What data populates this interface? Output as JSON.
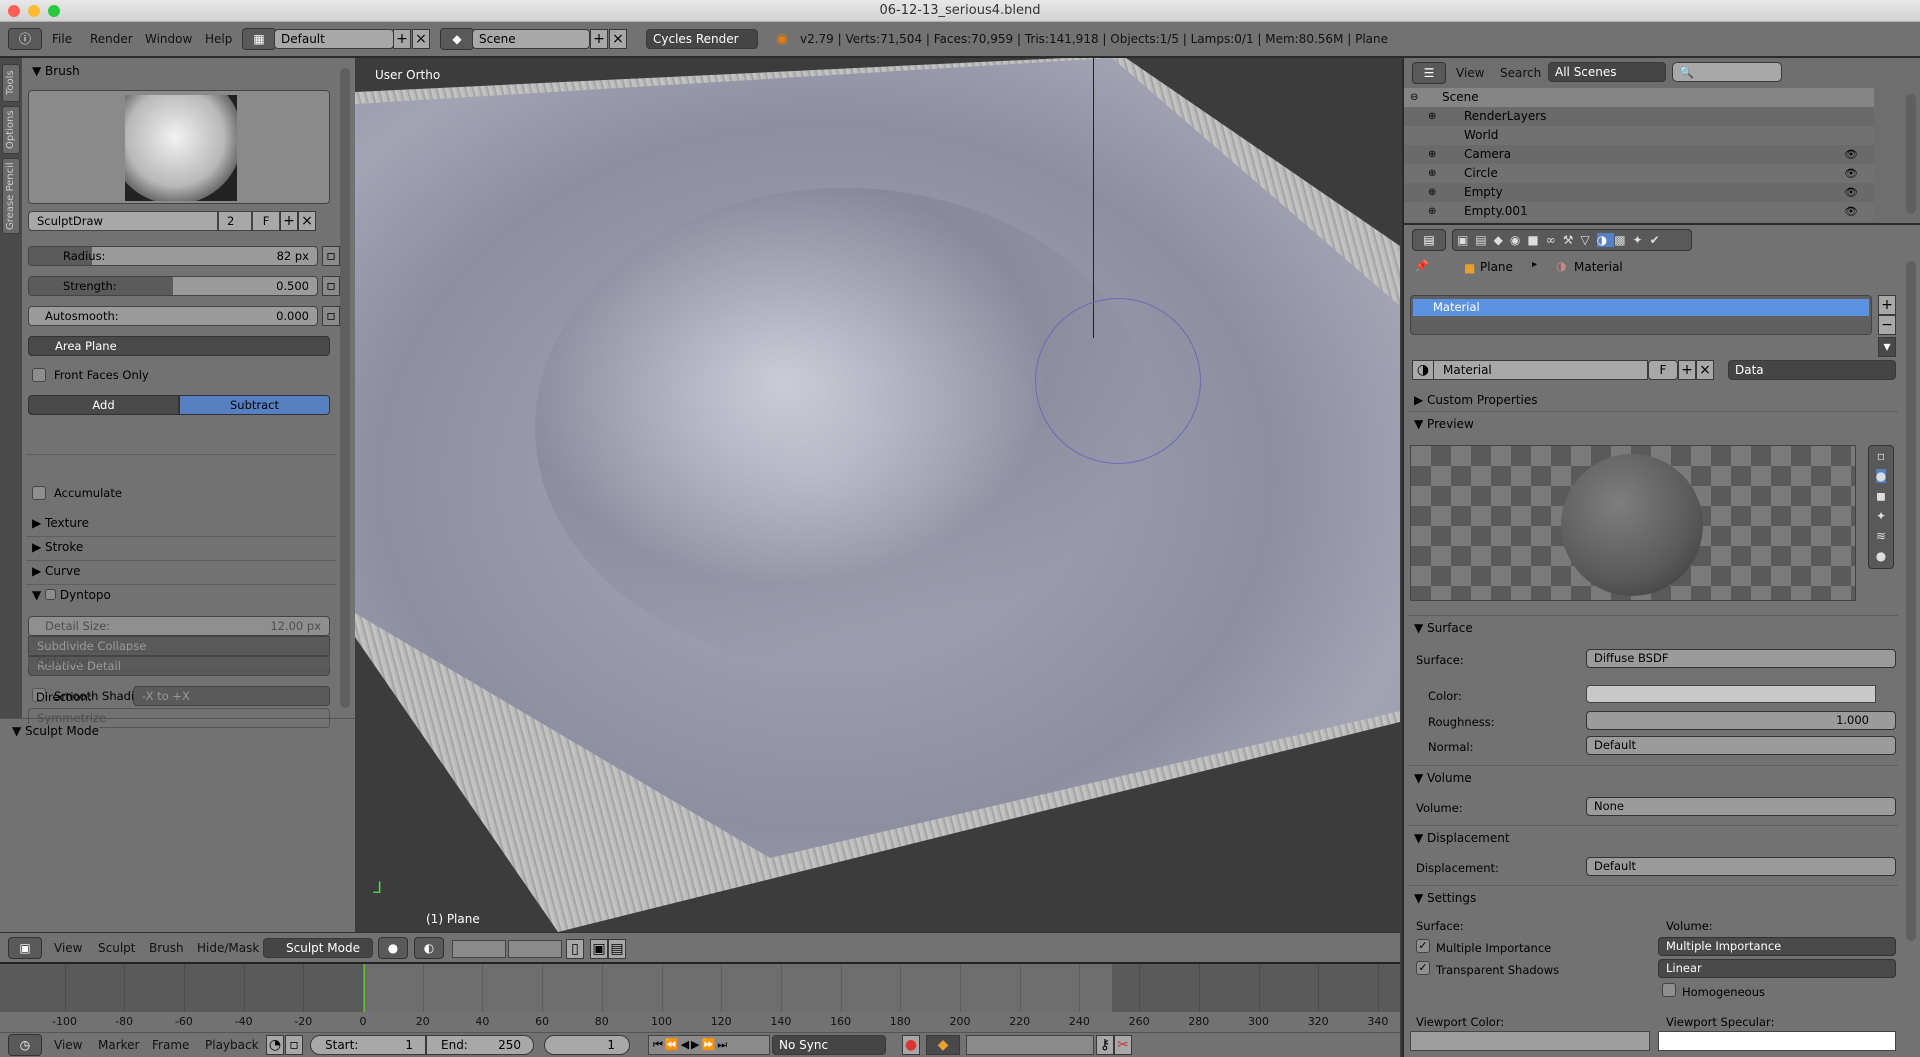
{
  "window": {
    "title": "06-12-13_serious4.blend"
  },
  "topbar": {
    "menus": [
      "File",
      "Render",
      "Window",
      "Help"
    ],
    "layout": "Default",
    "scene": "Scene",
    "engine": "Cycles Render",
    "stats": "v2.79 | Verts:71,504 | Faces:70,959 | Tris:141,918 | Objects:1/5 | Lamps:0/1 | Mem:80.56M | Plane"
  },
  "lefttabs": [
    "Tools",
    "Options",
    "Grease Pencil"
  ],
  "tools": {
    "brush_header": "Brush",
    "brush_name": "SculptDraw",
    "brush_users": "2",
    "fake_user": "F",
    "radius_label": "Radius:",
    "radius_value": "82 px",
    "radius_fraction": 0.22,
    "strength_label": "Strength:",
    "strength_value": "0.500",
    "strength_fraction": 0.5,
    "autosmooth_label": "Autosmooth:",
    "autosmooth_value": "0.000",
    "area_plane": "Area Plane",
    "front_faces": "Front Faces Only",
    "add": "Add",
    "subtract": "Subtract",
    "accumulate": "Accumulate",
    "texture": "Texture",
    "stroke": "Stroke",
    "curve": "Curve",
    "dyntopo": "Dyntopo",
    "detail_size_label": "Detail Size:",
    "detail_size_value": "12.00 px",
    "subdivide": "Subdivide Collapse",
    "relative": "Relative Detail",
    "smooth": "Smooth Shading",
    "optimize": "Optimize",
    "direction_label": "Direction:",
    "direction_value": "-X to +X",
    "symmetrize": "Symmetrize",
    "sculpt_mode": "Sculpt Mode"
  },
  "viewport": {
    "view_label": "User Ortho",
    "object_label": "(1) Plane"
  },
  "vpheader": {
    "menus": [
      "View",
      "Sculpt",
      "Brush",
      "Hide/Mask"
    ],
    "mode": "Sculpt Mode"
  },
  "timeline": {
    "ticks": [
      "-100",
      "-80",
      "-60",
      "-40",
      "-20",
      "0",
      "20",
      "40",
      "60",
      "80",
      "100",
      "120",
      "140",
      "160",
      "180",
      "200",
      "220",
      "240",
      "260",
      "280",
      "300",
      "320",
      "340"
    ],
    "current_frame": "1",
    "menus": [
      "View",
      "Marker",
      "Frame",
      "Playback"
    ],
    "start_label": "Start:",
    "start": "1",
    "end_label": "End:",
    "end": "250",
    "sync": "No Sync"
  },
  "outliner": {
    "menus": [
      "View",
      "Search"
    ],
    "filter": "All Scenes",
    "items": [
      {
        "name": "Scene",
        "level": 0
      },
      {
        "name": "RenderLayers",
        "level": 1
      },
      {
        "name": "World",
        "level": 1
      },
      {
        "name": "Camera",
        "level": 1
      },
      {
        "name": "Circle",
        "level": 1
      },
      {
        "name": "Empty",
        "level": 1
      },
      {
        "name": "Empty.001",
        "level": 1
      }
    ]
  },
  "properties": {
    "breadcrumb": [
      "Plane",
      "Material"
    ],
    "slot": "Material",
    "material_name": "Material",
    "fake": "F",
    "link": "Data",
    "custom_props": "Custom Properties",
    "preview": "Preview",
    "surface_header": "Surface",
    "surface_label": "Surface:",
    "surface_value": "Diffuse BSDF",
    "color_label": "Color:",
    "color_value": "#c8c8c8",
    "roughness_label": "Roughness:",
    "roughness_value": "1.000",
    "normal_label": "Normal:",
    "normal_value": "Default",
    "volume_header": "Volume",
    "volume_label": "Volume:",
    "volume_value": "None",
    "disp_header": "Displacement",
    "disp_label": "Displacement:",
    "disp_value": "Default",
    "settings_header": "Settings",
    "set_surface": "Surface:",
    "set_volume": "Volume:",
    "multiple_importance": "Multiple Importance",
    "transparent_shadows": "Transparent Shadows",
    "vol_sampling": "Multiple Importance",
    "vol_interp": "Linear",
    "homogeneous": "Homogeneous",
    "viewport_color": "Viewport Color:",
    "viewport_specular": "Viewport Specular:"
  },
  "colors": {
    "accent": "#5680c2",
    "selected": "#5b93e0",
    "frame_line": "#60c040"
  }
}
